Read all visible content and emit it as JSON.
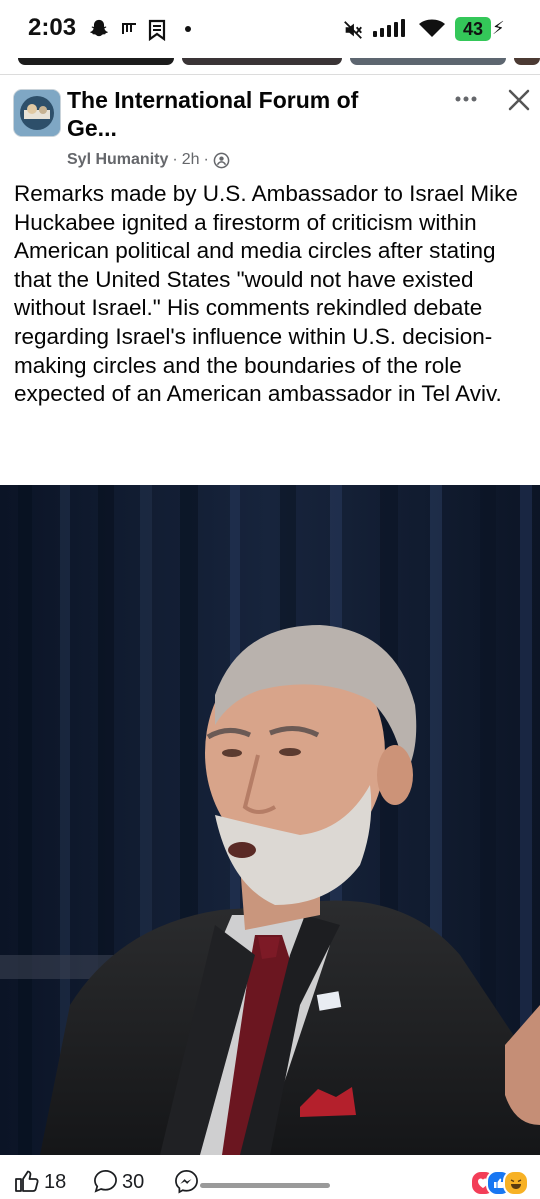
{
  "status_bar": {
    "time": "2:03",
    "battery": "43",
    "battery_color": "#34c759"
  },
  "post": {
    "group_name": "The International Forum of Ge...",
    "author": "Syl Humanity",
    "time_ago": "2h",
    "separator": "·",
    "audience_icon": "friends-icon",
    "text": "Remarks made by U.S. Ambassador to Israel Mike Huckabee ignited a firestorm of criticism within American political and media circles after stating that the United States \"would not have existed without Israel.\" His comments rekindled debate regarding Israel's influence within U.S. decision-making circles and the boundaries of the role expected of an American ambassador in Tel Aviv."
  },
  "actions": {
    "like_count": "18",
    "comment_count": "30"
  },
  "colors": {
    "text_primary": "#050505",
    "text_secondary": "#65676b",
    "reaction_love": "#f33e58",
    "reaction_like": "#1877f2",
    "reaction_haha": "#f7b125"
  }
}
